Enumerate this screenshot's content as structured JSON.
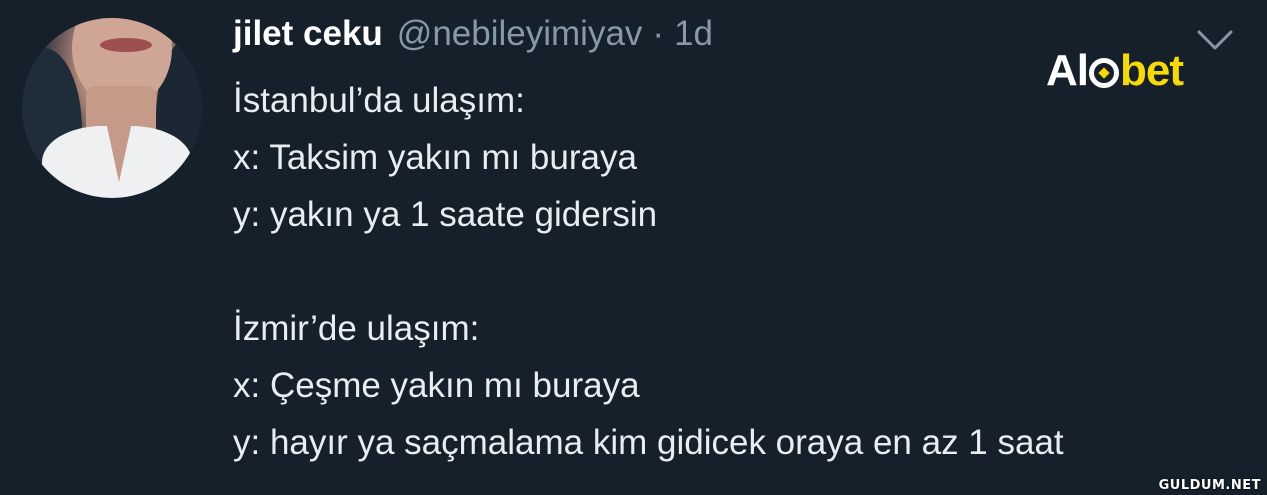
{
  "tweet": {
    "display_name": "jilet ceku",
    "handle": "@nebileyimiyav",
    "separator": "·",
    "timestamp": "1d",
    "lines": [
      "İstanbul’da ulaşım:",
      "x: Taksim yakın mı buraya",
      "y: yakın ya 1 saate gidersin",
      "",
      "İzmir’de ulaşım:",
      "x: Çeşme yakın mı buraya",
      "y: hayır ya saçmalama kim gidicek oraya en az 1 saat"
    ]
  },
  "logo": {
    "part1": "Al",
    "part2": "bet"
  },
  "watermark": "GULDUM.NET",
  "colors": {
    "background": "#15202b",
    "text": "#e8edf2",
    "muted": "#8899a6",
    "brand_yellow": "#f5d90a"
  },
  "icons": {
    "menu": "chevron-down-icon"
  }
}
